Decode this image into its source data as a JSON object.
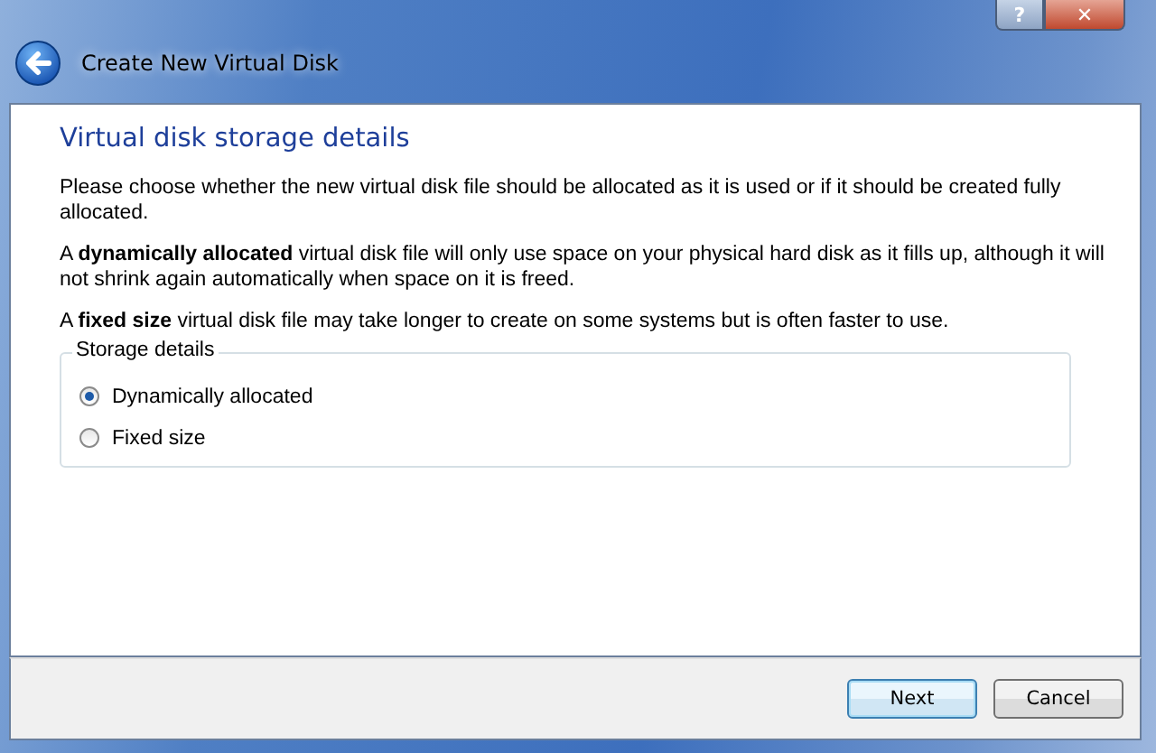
{
  "window": {
    "title": "Create New Virtual Disk",
    "caption_buttons": [
      {
        "kind": "help",
        "label": "?"
      },
      {
        "kind": "close",
        "label": "✕"
      }
    ]
  },
  "heading": "Virtual disk storage details",
  "paragraphs": [
    "Please choose whether the new virtual disk file should be allocated as it is used or if it should be created fully allocated.",
    "A **dynamically allocated** virtual disk file will only use space on your physical hard disk as it fills up, although it will not shrink again automatically when space on it is freed.",
    "A **fixed size** virtual disk file may take longer to create on some systems but is often faster to use."
  ],
  "storage_details": {
    "title": "Storage details",
    "options": [
      {
        "label": "Dynamically allocated",
        "selected": true
      },
      {
        "label": "Fixed size",
        "selected": false
      }
    ]
  },
  "buttons": [
    {
      "label": "Next",
      "default": true
    },
    {
      "label": "Cancel",
      "default": false
    }
  ]
}
